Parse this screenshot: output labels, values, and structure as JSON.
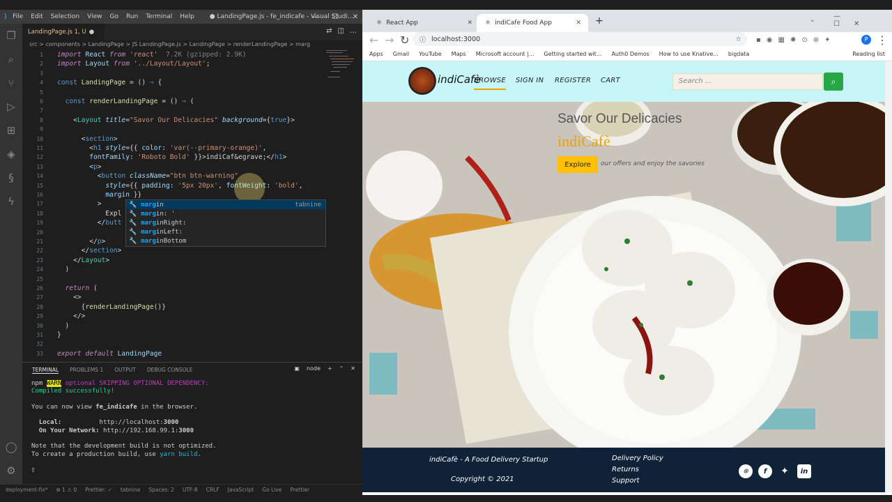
{
  "vscode": {
    "menu": [
      "File",
      "Edit",
      "Selection",
      "View",
      "Go",
      "Run",
      "Terminal",
      "Help"
    ],
    "title": "● LandingPage.js - fe_indicafe - Visual Studi...",
    "tab": "LandingPage.js 1, U",
    "breadcrumb": "src > components > LandingPage > JS LandingPage.js > LandingPage > renderLandingPage > marg",
    "code": [
      {
        "n": "1",
        "html": "<span class='k'>import</span> <span class='v'>React</span> <span class='k'>from</span> <span class='s'>'react'</span>  <span class='g'>7.2K (gzipped: 2.9K)</span>"
      },
      {
        "n": "2",
        "html": "<span class='k'>import</span> <span class='v'>Layout</span> <span class='k'>from</span> <span class='s'>'../Layout/Layout'</span>;"
      },
      {
        "n": "3",
        "html": ""
      },
      {
        "n": "4",
        "html": "<span class='b'>const</span> <span class='f'>LandingPage</span> = () <span class='b'>⇒</span> {"
      },
      {
        "n": "5",
        "html": ""
      },
      {
        "n": "6",
        "html": "  <span class='b'>const</span> <span class='f'>renderLandingPage</span> = () <span class='b'>⇒</span> ("
      },
      {
        "n": "7",
        "html": ""
      },
      {
        "n": "8",
        "html": "    &lt;<span class='t'>Layout</span> <span class='at'>title</span>=<span class='s'>\"Savor Our Delicacies\"</span> <span class='at'>background</span>={<span class='b'>true</span>}&gt;"
      },
      {
        "n": "9",
        "html": ""
      },
      {
        "n": "10",
        "html": "      &lt;<span class='b'>section</span>&gt;"
      },
      {
        "n": "11",
        "html": "        &lt;<span class='b'>h1</span> <span class='at'>style</span>={{ <span class='v'>color</span>: <span class='s'>'var(--primary-orange)'</span>,"
      },
      {
        "n": "12",
        "html": "        <span class='v'>fontFamily</span>: <span class='s'>'Roboto Bold'</span> }}&gt;indiCaf&amp;egrave;&lt;/<span class='b'>h1</span>&gt;"
      },
      {
        "n": "13",
        "html": "        &lt;<span class='b'>p</span>&gt;"
      },
      {
        "n": "14",
        "html": "          &lt;<span class='b'>button</span> <span class='at'>className</span>=<span class='s'>\"btn btn-warning\"</span>"
      },
      {
        "n": "15",
        "html": "            <span class='at'>style</span>={{ <span class='v'>padding</span>: <span class='s'>'5px 20px'</span>, <span class='v'>fontWeight</span>: <span class='s'>'bold'</span>,"
      },
      {
        "n": "16",
        "html": "            <span class='v'>margin</span> }}"
      },
      {
        "n": "17",
        "html": "          &gt;"
      },
      {
        "n": "18",
        "html": "            Expl"
      },
      {
        "n": "19",
        "html": "          &lt;/<span class='b'>butt</span>"
      },
      {
        "n": "20",
        "html": ""
      },
      {
        "n": "21",
        "html": "        &lt;/<span class='b'>p</span>&gt;"
      },
      {
        "n": "22",
        "html": "      &lt;/<span class='b'>section</span>&gt;"
      },
      {
        "n": "23",
        "html": "    &lt;/<span class='t'>Layout</span>&gt;"
      },
      {
        "n": "24",
        "html": "  )"
      },
      {
        "n": "25",
        "html": ""
      },
      {
        "n": "26",
        "html": "  <span class='k'>return</span> ("
      },
      {
        "n": "27",
        "html": "    &lt;&gt;"
      },
      {
        "n": "28",
        "html": "      {<span class='f'>renderLandingPage</span>()}"
      },
      {
        "n": "29",
        "html": "    &lt;/&gt;"
      },
      {
        "n": "30",
        "html": "  )"
      },
      {
        "n": "31",
        "html": "}"
      },
      {
        "n": "32",
        "html": ""
      },
      {
        "n": "33",
        "html": "<span class='k'>export</span> <span class='k'>default</span> <span class='v'>LandingPage</span>"
      }
    ],
    "suggestions": [
      {
        "hl": "marg",
        "rest": "in",
        "right": "tabnine"
      },
      {
        "hl": "marg",
        "rest": "in: '",
        "right": ""
      },
      {
        "hl": "marg",
        "rest": "inRight:",
        "right": ""
      },
      {
        "hl": "marg",
        "rest": "inLeft:",
        "right": ""
      },
      {
        "hl": "marg",
        "rest": "inBottom",
        "right": ""
      }
    ],
    "panel_tabs": [
      "TERMINAL",
      "PROBLEMS 1",
      "OUTPUT",
      "DEBUG CONSOLE"
    ],
    "panel_right": "node",
    "terminal": {
      "l1a": "npm ",
      "l1warn": "WARN",
      "l1b": " optional SKIPPING OPTIONAL DEPENDENCY:",
      "l2": "Compiled successfully!",
      "l3a": "You can now view ",
      "l3b": "fe_indicafe",
      "l3c": " in the browser.",
      "l4a": "  Local:",
      "l4b": "http://localhost:",
      "l4c": "3000",
      "l5a": "  On Your Network:",
      "l5b": "http://192.168.99.1:",
      "l5c": "3000",
      "l6": "Note that the development build is not optimized.",
      "l7a": "To create a production build, use ",
      "l7b": "yarn build",
      "l7c": "."
    },
    "status": [
      "deployment-fix*",
      "⊗ 1 ⚠ 0",
      "Prettier: ✓",
      "tabnine",
      "Spaces: 2",
      "UTF-8",
      "CRLF",
      "JavaScript",
      "Go Live",
      "Prettier"
    ]
  },
  "chrome": {
    "tabs": [
      "React App",
      "indiCafe Food App"
    ],
    "url": "localhost:3000",
    "bookmarks": [
      "Apps",
      "Gmail",
      "YouTube",
      "Maps",
      "Microsoft account |...",
      "Getting started wit...",
      "Auth0 Demos",
      "How to use Knative...",
      "bigdata",
      "Reading list"
    ]
  },
  "site": {
    "logo_text": "indiCafè",
    "nav": [
      "BROWSE",
      "SIGN IN",
      "REGISTER",
      "CART"
    ],
    "search_placeholder": "Search ...",
    "hero_title": "Savor Our Delicacies",
    "hero_brand": "indiCafè",
    "explore": "Explore",
    "hero_sub": "our offers and enjoy the savories",
    "footer_tag": "indiCafè - A Food Delivery Startup",
    "footer_copy": "Copyright © 2021",
    "footer_links": [
      "Delivery Policy",
      "Returns",
      "Support"
    ],
    "social": [
      "github-icon",
      "facebook-icon",
      "twitter-icon",
      "linkedin-icon"
    ],
    "colors": {
      "nav_bg": "#c8f5f7",
      "footer_bg": "#0f2237",
      "accent": "#ffc107",
      "search_btn": "#28a745"
    }
  }
}
